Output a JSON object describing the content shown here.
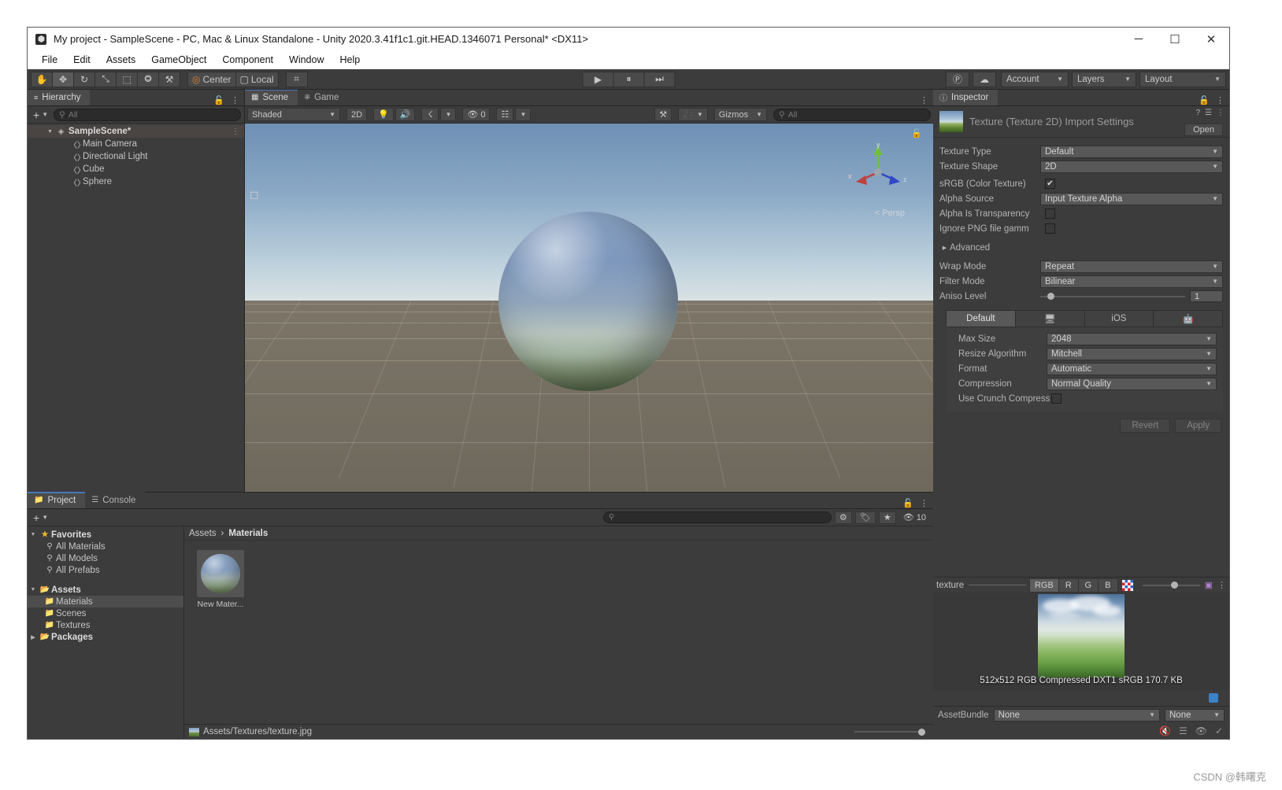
{
  "window": {
    "title": "My project - SampleScene - PC, Mac & Linux Standalone - Unity 2020.3.41f1c1.git.HEAD.1346071 Personal* <DX11>",
    "minimize": "─",
    "maximize": "☐",
    "close": "✕"
  },
  "menu": [
    "File",
    "Edit",
    "Assets",
    "GameObject",
    "Component",
    "Window",
    "Help"
  ],
  "toolbar": {
    "tools": [
      {
        "name": "hand-tool",
        "glyph": "✋"
      },
      {
        "name": "move-tool",
        "glyph": "✥"
      },
      {
        "name": "rotate-tool",
        "glyph": "↻"
      },
      {
        "name": "scale-tool",
        "glyph": "⤡"
      },
      {
        "name": "rect-tool",
        "glyph": "⬚"
      },
      {
        "name": "transform-tool",
        "glyph": "⭗"
      },
      {
        "name": "custom-tool",
        "glyph": "⚒"
      }
    ],
    "pivot": "Center",
    "handle": "Local",
    "grid_snap": "⌗",
    "play": "▶",
    "pause": "⏸",
    "step": "⏭",
    "collab": "Ⓟ",
    "cloud": "☁",
    "account": "Account",
    "layers": "Layers",
    "layout": "Layout"
  },
  "hierarchy": {
    "tab": "Hierarchy",
    "tab_icon": "list-icon",
    "add_label": "+",
    "search_placeholder": "All",
    "items": [
      {
        "label": "SampleScene*",
        "icon": "scene-icon",
        "depth": 0,
        "selected": true,
        "expanded": true
      },
      {
        "label": "Main Camera",
        "icon": "gameobject-icon",
        "depth": 1
      },
      {
        "label": "Directional Light",
        "icon": "gameobject-icon",
        "depth": 1
      },
      {
        "label": "Cube",
        "icon": "gameobject-icon",
        "depth": 1
      },
      {
        "label": "Sphere",
        "icon": "gameobject-icon",
        "depth": 1
      }
    ]
  },
  "scene": {
    "tabs": [
      {
        "label": "Scene",
        "icon": "grid-icon",
        "active": true
      },
      {
        "label": "Game",
        "icon": "gamepad-icon",
        "active": false
      }
    ],
    "draw_mode": "Shaded",
    "two_d": "2D",
    "light_toggle": "Ὂ1",
    "audio_toggle": "ὐA",
    "fx_toggle": "✨",
    "hidden_count": "0",
    "grid_toggle": "⌗",
    "gizmos": "Gizmos",
    "search_placeholder": "All",
    "persp_label": "Persp",
    "axis_labels": {
      "x": "x",
      "y": "y",
      "z": "z"
    }
  },
  "project": {
    "tabs": [
      {
        "label": "Project",
        "icon": "folder-icon",
        "active": true
      },
      {
        "label": "Console",
        "icon": "console-icon",
        "active": false
      }
    ],
    "add_label": "+",
    "search_placeholder": "",
    "badge_count": "10",
    "tree": [
      {
        "label": "Favorites",
        "icon": "star-icon",
        "depth": 0,
        "bold": true,
        "expanded": true
      },
      {
        "label": "All Materials",
        "icon": "search-icon",
        "depth": 1
      },
      {
        "label": "All Models",
        "icon": "search-icon",
        "depth": 1
      },
      {
        "label": "All Prefabs",
        "icon": "search-icon",
        "depth": 1
      },
      {
        "label": "Assets",
        "icon": "folder-open-icon",
        "depth": 0,
        "bold": true,
        "expanded": true,
        "spacer": true
      },
      {
        "label": "Materials",
        "icon": "folder-icon",
        "depth": 1,
        "selected": true
      },
      {
        "label": "Scenes",
        "icon": "folder-icon",
        "depth": 1
      },
      {
        "label": "Textures",
        "icon": "folder-icon",
        "depth": 1
      },
      {
        "label": "Packages",
        "icon": "folder-open-icon",
        "depth": 0,
        "bold": true,
        "expanded": false
      }
    ],
    "breadcrumb": [
      "Assets",
      "Materials"
    ],
    "breadcrumb_sep": "›",
    "assets": [
      {
        "label": "New Mater...",
        "icon": "material-sphere-icon"
      }
    ],
    "status_path": "Assets/Textures/texture.jpg"
  },
  "inspector": {
    "tab": "Inspector",
    "tab_icon": "info-icon",
    "title": "Texture (Texture 2D) Import Settings",
    "open_button": "Open",
    "help_icon": "?",
    "preset_icon": "☰",
    "menu_icon": "⋮",
    "fields": [
      {
        "label": "Texture Type",
        "value": "Default",
        "kind": "dropdown"
      },
      {
        "label": "Texture Shape",
        "value": "2D",
        "kind": "dropdown"
      },
      {
        "label": "sRGB (Color Texture)",
        "value": "✔",
        "kind": "checkbox",
        "checked": true
      },
      {
        "label": "Alpha Source",
        "value": "Input Texture Alpha",
        "kind": "dropdown"
      },
      {
        "label": "Alpha Is Transparency",
        "value": "",
        "kind": "checkbox",
        "checked": false
      },
      {
        "label": "Ignore PNG file gamm",
        "value": "",
        "kind": "checkbox",
        "checked": false
      }
    ],
    "advanced_label": "Advanced",
    "advanced_expanded": false,
    "fields2": [
      {
        "label": "Wrap Mode",
        "value": "Repeat",
        "kind": "dropdown"
      },
      {
        "label": "Filter Mode",
        "value": "Bilinear",
        "kind": "dropdown"
      }
    ],
    "aniso_label": "Aniso Level",
    "aniso_value": "1",
    "platform_tabs": [
      {
        "label": "Default",
        "icon": "",
        "active": true
      },
      {
        "label": "",
        "icon": "monitor-icon",
        "active": false
      },
      {
        "label": "iOS",
        "icon": "",
        "active": false
      },
      {
        "label": "",
        "icon": "android-icon",
        "active": false
      }
    ],
    "platform_fields": [
      {
        "label": "Max Size",
        "value": "2048",
        "kind": "dropdown"
      },
      {
        "label": "Resize Algorithm",
        "value": "Mitchell",
        "kind": "dropdown"
      },
      {
        "label": "Format",
        "value": "Automatic",
        "kind": "dropdown"
      },
      {
        "label": "Compression",
        "value": "Normal Quality",
        "kind": "dropdown"
      },
      {
        "label": "Use Crunch Compress",
        "value": "",
        "kind": "checkbox",
        "checked": false
      }
    ],
    "revert_button": "Revert",
    "apply_button": "Apply",
    "preview": {
      "name": "texture",
      "channels": [
        "RGB",
        "R",
        "G",
        "B"
      ],
      "active_channel": "RGB",
      "info": "512x512  RGB Compressed DXT1 sRGB  170.7 KB"
    },
    "assetbundle": {
      "label": "AssetBundle",
      "value": "None",
      "variant": "None"
    }
  },
  "watermark": "CSDN @韩曙克"
}
